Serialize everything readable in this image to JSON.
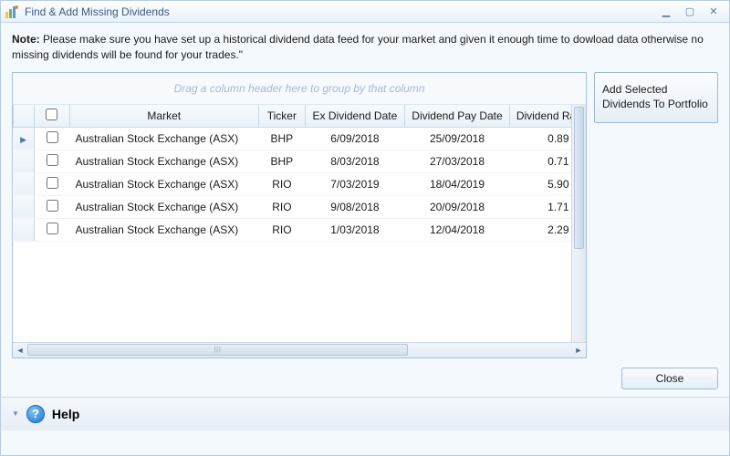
{
  "window": {
    "title": "Find & Add Missing Dividends"
  },
  "note": {
    "label": "Note:",
    "text": " Please make sure you have set up a historical dividend data feed for your market and given it enough time to dowload data otherwise no missing dividends will be found for your trades.\""
  },
  "grid": {
    "group_hint": "Drag a column header here to group by that column",
    "columns": {
      "market": "Market",
      "ticker": "Ticker",
      "exdate": "Ex Dividend Date",
      "paydate": "Dividend Pay Date",
      "rate": "Dividend Rat"
    },
    "rows": [
      {
        "market": "Australian Stock Exchange (ASX)",
        "ticker": "BHP",
        "exdate": "6/09/2018",
        "paydate": "25/09/2018",
        "rate": "0.89"
      },
      {
        "market": "Australian Stock Exchange (ASX)",
        "ticker": "BHP",
        "exdate": "8/03/2018",
        "paydate": "27/03/2018",
        "rate": "0.71"
      },
      {
        "market": "Australian Stock Exchange (ASX)",
        "ticker": "RIO",
        "exdate": "7/03/2019",
        "paydate": "18/04/2019",
        "rate": "5.90"
      },
      {
        "market": "Australian Stock Exchange (ASX)",
        "ticker": "RIO",
        "exdate": "9/08/2018",
        "paydate": "20/09/2018",
        "rate": "1.71"
      },
      {
        "market": "Australian Stock Exchange (ASX)",
        "ticker": "RIO",
        "exdate": "1/03/2018",
        "paydate": "12/04/2018",
        "rate": "2.29"
      }
    ]
  },
  "sidebar": {
    "add_label": "Add Selected Dividends To Portfolio"
  },
  "footer": {
    "close_label": "Close"
  },
  "help": {
    "label": "Help"
  }
}
